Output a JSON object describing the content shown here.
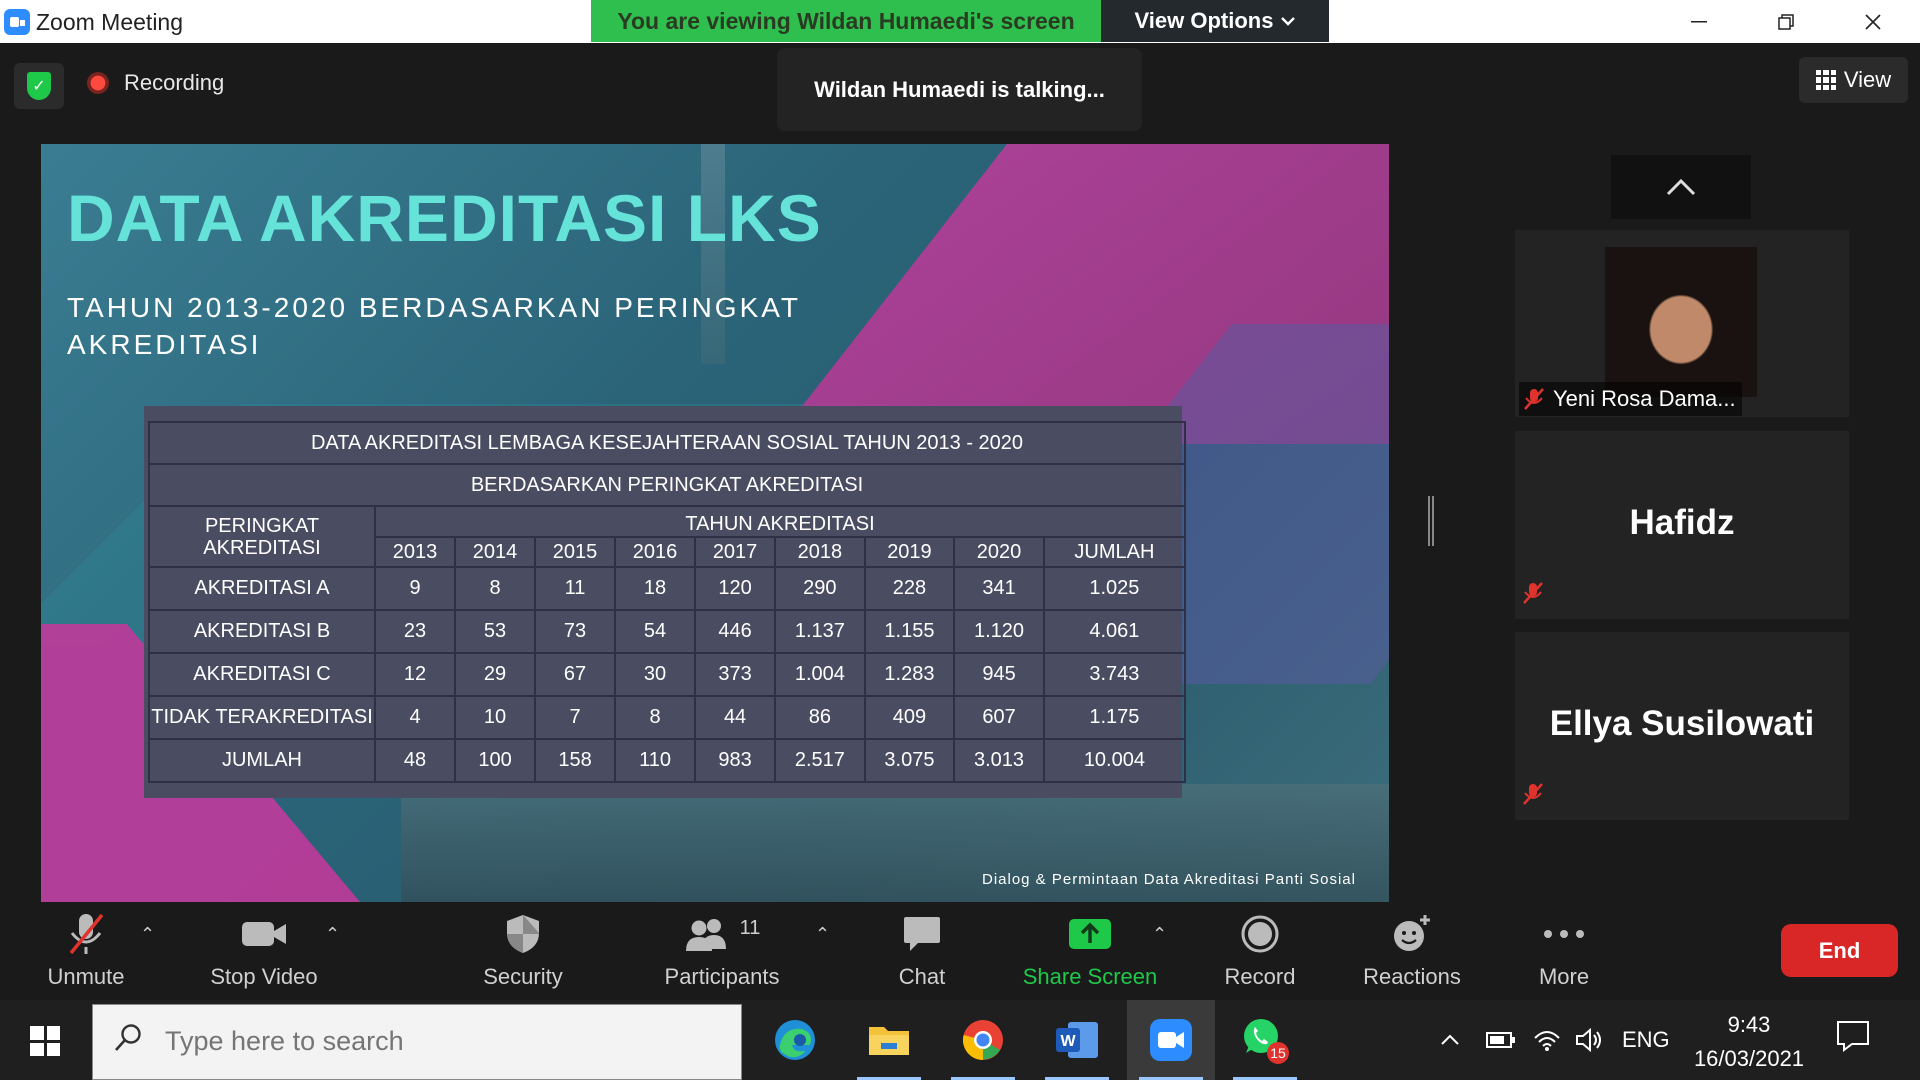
{
  "window": {
    "title": "Zoom Meeting",
    "share_banner": "You are viewing Wildan Humaedi's screen",
    "view_options": "View Options",
    "minimize": "—",
    "restore": "❐",
    "close": "✕"
  },
  "meeting": {
    "recording_label": "Recording",
    "talking_notice": "Wildan Humaedi is talking...",
    "view_label": "View"
  },
  "slide": {
    "title": "DATA AKREDITASI LKS",
    "subtitle": "TAHUN 2013-2020 BERDASARKAN PERINGKAT AKREDITASI",
    "footer": "Dialog & Permintaan Data Akreditasi  Panti Sosial",
    "table": {
      "title_row1": "DATA AKREDITASI LEMBAGA KESEJAHTERAAN SOSIAL TAHUN 2013 - 2020",
      "title_row2": "BERDASARKAN PERINGKAT AKREDITASI",
      "rank_header": "PERINGKAT AKREDITASI",
      "year_header": "TAHUN AKREDITASI",
      "years": [
        "2013",
        "2014",
        "2015",
        "2016",
        "2017",
        "2018",
        "2019",
        "2020",
        "JUMLAH"
      ],
      "rows": [
        {
          "label": "AKREDITASI A",
          "values": [
            "9",
            "8",
            "11",
            "18",
            "120",
            "290",
            "228",
            "341",
            "1.025"
          ]
        },
        {
          "label": "AKREDITASI B",
          "values": [
            "23",
            "53",
            "73",
            "54",
            "446",
            "1.137",
            "1.155",
            "1.120",
            "4.061"
          ]
        },
        {
          "label": "AKREDITASI C",
          "values": [
            "12",
            "29",
            "67",
            "30",
            "373",
            "1.004",
            "1.283",
            "945",
            "3.743"
          ]
        },
        {
          "label": "TIDAK TERAKREDITASI",
          "values": [
            "4",
            "10",
            "7",
            "8",
            "44",
            "86",
            "409",
            "607",
            "1.175"
          ]
        },
        {
          "label": "JUMLAH",
          "values": [
            "48",
            "100",
            "158",
            "110",
            "983",
            "2.517",
            "3.075",
            "3.013",
            "10.004"
          ]
        }
      ]
    }
  },
  "participants": [
    {
      "name": "Yeni Rosa Dama...",
      "has_video": true
    },
    {
      "name": "Hafidz",
      "has_video": false
    },
    {
      "name": "Ellya Susilowati",
      "has_video": false
    }
  ],
  "toolbar": {
    "unmute": "Unmute",
    "stop_video": "Stop Video",
    "security": "Security",
    "participants": "Participants",
    "participants_count": "11",
    "chat": "Chat",
    "share_screen": "Share Screen",
    "record": "Record",
    "reactions": "Reactions",
    "more": "More",
    "end": "End"
  },
  "taskbar": {
    "search_placeholder": "Type here to search",
    "whatsapp_badge": "15",
    "language": "ENG",
    "time": "9:43",
    "date": "16/03/2021"
  },
  "colors": {
    "share_banner": "#2fbf4f",
    "slide_title": "#66e3d9",
    "end_button": "#d92626",
    "share_screen": "#1ec94a"
  }
}
